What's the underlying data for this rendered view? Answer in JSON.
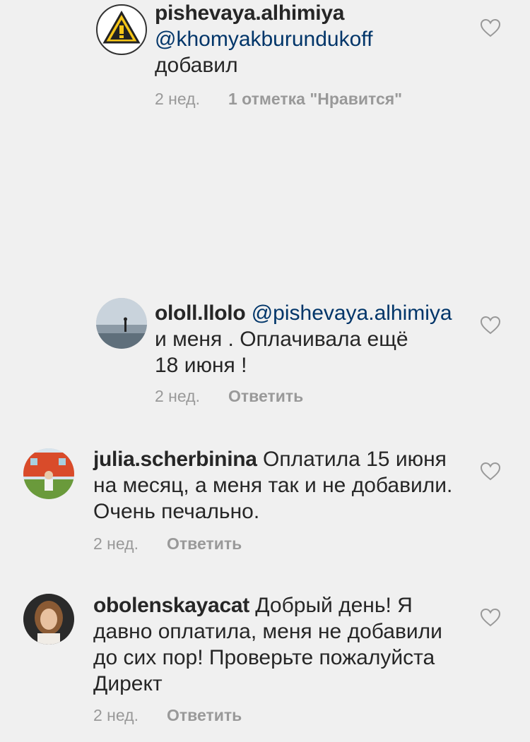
{
  "comments": [
    {
      "username": "pishevaya.alhimiya",
      "mention": "@khomyakburundukoff",
      "text": "добавил",
      "time": "2 нед.",
      "action": "1 отметка \"Нравится\"",
      "avatar_icon": "caution-triangle-logo"
    },
    {
      "username": "ololl.llolo",
      "mention": "@pishevaya.alhimiya",
      "text_line1": "и меня . Оплачивала ещё",
      "text_line2": "18 июня !",
      "time": "2 нед.",
      "action": "Ответить",
      "avatar_icon": "seaside-photo"
    },
    {
      "username": "julia.scherbinina",
      "text_line1": "Оплатила 15 июня",
      "text_line2": "на месяц, а меня так и не добавили.",
      "text_line3": "Очень печально.",
      "time": "2 нед.",
      "action": "Ответить",
      "avatar_icon": "person-outdoor-photo"
    },
    {
      "username": "obolenskayacat",
      "text_line1": "Добрый день! Я",
      "text_line2": "давно оплатила, меня не добавили",
      "text_line3": "до сих пор! Проверьте пожалуйста",
      "text_line4": "Директ",
      "time": "2 нед.",
      "action": "Ответить",
      "avatar_icon": "woman-portrait-photo"
    }
  ],
  "colors": {
    "background": "#f0f0f0",
    "username": "#262626",
    "mention": "#003569",
    "meta": "#999999"
  }
}
